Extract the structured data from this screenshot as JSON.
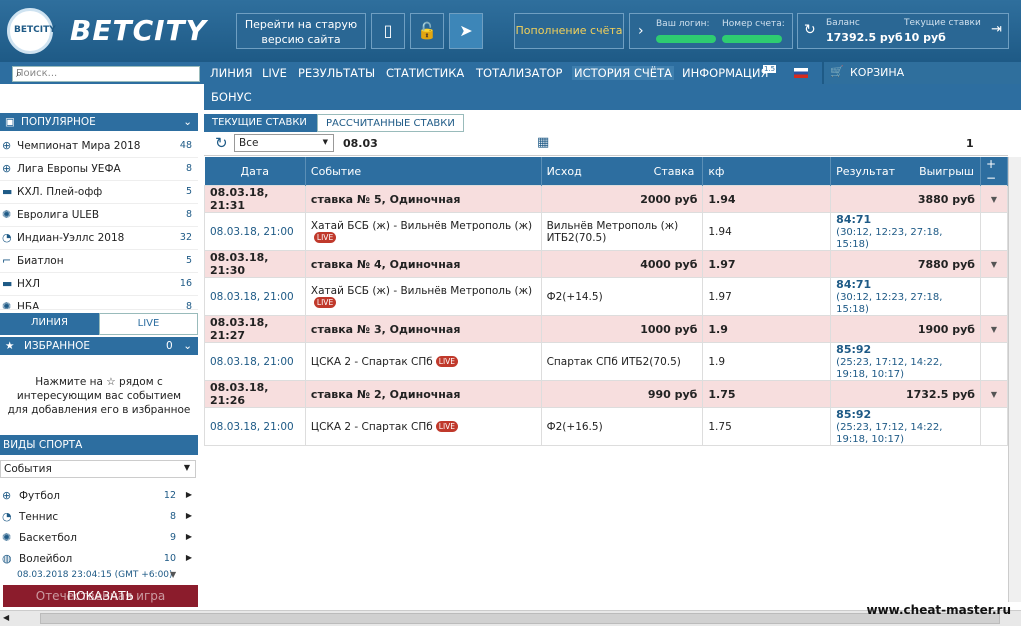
{
  "header": {
    "logo_ball_text": "BETCITY",
    "logo": "BETCITY",
    "old_site": "Перейти на старую версию сайта",
    "topup": "Пополнение счёта",
    "login_label": "Ваш логин:",
    "account_label": "Номер счета:",
    "balance_label": "Баланс",
    "balance_value": "17392.5 руб",
    "current_bets_label": "Текущие ставки",
    "current_bets_value": "10 руб"
  },
  "nav": {
    "search_placeholder": "Поиск...",
    "items": [
      "ЛИНИЯ",
      "LIVE",
      "РЕЗУЛЬТАТЫ",
      "СТАТИСТИКА",
      "ТОТАЛИЗАТОР",
      "ИСТОРИЯ СЧЁТА",
      "ИНФОРМАЦИЯ"
    ],
    "info_badge": "1.5",
    "cart": "КОРЗИНА",
    "bonus": "БОНУС"
  },
  "sidebar": {
    "popular": "ПОПУЛЯРНОЕ",
    "items": [
      {
        "label": "Чемпионат Мира 2018",
        "count": "48"
      },
      {
        "label": "Лига Европы УЕФА",
        "count": "8"
      },
      {
        "label": "КХЛ. Плей-офф",
        "count": "5"
      },
      {
        "label": "Евролига ULEB",
        "count": "8"
      },
      {
        "label": "Индиан-Уэллс 2018",
        "count": "32"
      },
      {
        "label": "Биатлон",
        "count": "5"
      },
      {
        "label": "НХЛ",
        "count": "16"
      },
      {
        "label": "НБА",
        "count": "8"
      }
    ],
    "tab_line": "ЛИНИЯ",
    "tab_live": "LIVE",
    "favorites": "ИЗБРАННОЕ",
    "favorites_count": "0",
    "fav_hint": "Нажмите на ☆ рядом с интересующим вас событием для добавления его в избранное",
    "sports_title": "ВИДЫ СПОРТА",
    "sports_select": "События",
    "sports": [
      {
        "label": "Футбол",
        "count": "12"
      },
      {
        "label": "Теннис",
        "count": "8"
      },
      {
        "label": "Баскетбол",
        "count": "9"
      },
      {
        "label": "Волейбол",
        "count": "10"
      }
    ],
    "datetime": "08.03.2018 23:04:15 (GMT +6:00)",
    "show_button": "ПОКАЗАТЬ",
    "virtual": "Отечественная игра"
  },
  "tabs": {
    "current": "ТЕКУЩИЕ СТАВКИ",
    "settled": "РАССЧИТАННЫЕ СТАВКИ"
  },
  "toolbar": {
    "filter": "Все",
    "date": "08.03",
    "page": "1"
  },
  "table": {
    "headers": [
      "Дата",
      "Событие",
      "Исход",
      "Ставка",
      "кф",
      "Результат",
      "Выигрыш"
    ],
    "bets": [
      {
        "date": "08.03.18, 21:31",
        "title": "ставка № 5, Одиночная",
        "stake": "2000 руб",
        "coef": "1.94",
        "win": "3880 руб",
        "ev_date": "08.03.18, 21:00",
        "event": "Хатай БСБ (ж) - Вильнёв Метрополь (ж)",
        "outcome": "Вильнёв Метрополь (ж) ИТБ2(70.5)",
        "ev_coef": "1.94",
        "score": "84:71",
        "detail": "(30:12, 12:23, 27:18, 15:18)"
      },
      {
        "date": "08.03.18, 21:30",
        "title": "ставка № 4, Одиночная",
        "stake": "4000 руб",
        "coef": "1.97",
        "win": "7880 руб",
        "ev_date": "08.03.18, 21:00",
        "event": "Хатай БСБ (ж) - Вильнёв Метрополь (ж)",
        "outcome": "Ф2(+14.5)",
        "ev_coef": "1.97",
        "score": "84:71",
        "detail": "(30:12, 12:23, 27:18, 15:18)"
      },
      {
        "date": "08.03.18, 21:27",
        "title": "ставка № 3, Одиночная",
        "stake": "1000 руб",
        "coef": "1.9",
        "win": "1900 руб",
        "ev_date": "08.03.18, 21:00",
        "event": "ЦСКА 2 - Спартак СПб",
        "outcome": "Спартак СПб ИТБ2(70.5)",
        "ev_coef": "1.9",
        "score": "85:92",
        "detail": "(25:23, 17:12, 14:22, 19:18, 10:17)"
      },
      {
        "date": "08.03.18, 21:26",
        "title": "ставка № 2, Одиночная",
        "stake": "990 руб",
        "coef": "1.75",
        "win": "1732.5 руб",
        "ev_date": "08.03.18, 21:00",
        "event": "ЦСКА 2 - Спартак СПб",
        "outcome": "Ф2(+16.5)",
        "ev_coef": "1.75",
        "score": "85:92",
        "detail": "(25:23, 17:12, 14:22, 19:18, 10:17)"
      }
    ],
    "live": "LIVE"
  },
  "watermark": "www.cheat-master.ru"
}
